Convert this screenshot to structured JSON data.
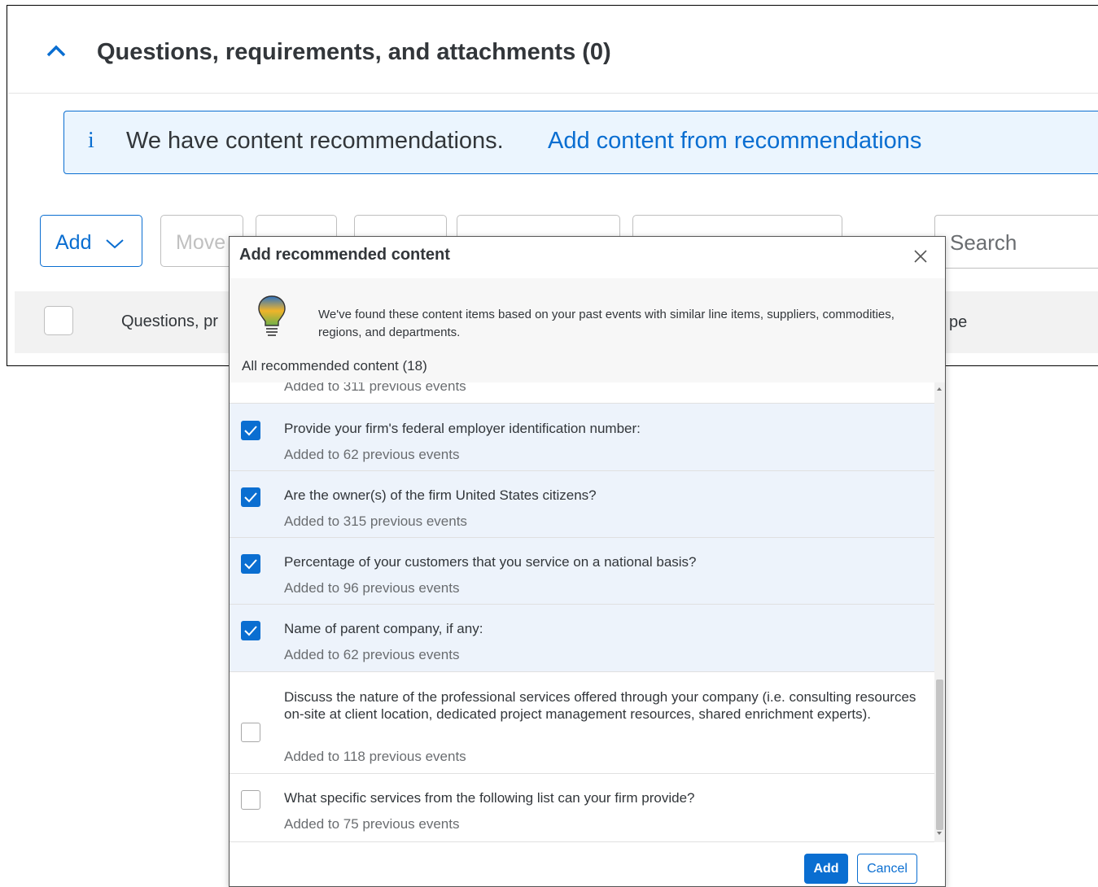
{
  "section": {
    "title": "Questions, requirements, and attachments (0)"
  },
  "info": {
    "text": "We have content recommendations.",
    "link": "Add content from recommendations"
  },
  "toolbar": {
    "add_label": "Add",
    "move_label": "Move",
    "search_placeholder": "Search"
  },
  "table": {
    "col1": "Questions, pr",
    "col2": "pe"
  },
  "dialog": {
    "title": "Add recommended content",
    "banner_text": "We've found these content items based on your past events with similar line items, suppliers, commodities, regions, and departments.",
    "count_label": "All recommended content (18)",
    "items": [
      {
        "title": "",
        "subtitle": "Added to 311 previous events",
        "checked": null
      },
      {
        "title": "Provide your firm's federal employer identification number:",
        "subtitle": "Added to 62 previous events",
        "checked": true
      },
      {
        "title": "Are the owner(s) of the firm United States citizens?",
        "subtitle": "Added to 315 previous events",
        "checked": true
      },
      {
        "title": "Percentage of your customers that you service on a national basis?",
        "subtitle": "Added to 96 previous events",
        "checked": true
      },
      {
        "title": "Name of parent company, if any:",
        "subtitle": "Added to 62 previous events",
        "checked": true
      },
      {
        "title": "Discuss the nature of the professional services offered through your company (i.e. consulting resources on-site at client location, dedicated project management resources, shared enrichment experts).",
        "subtitle": "Added to 118 previous events",
        "checked": false
      },
      {
        "title": "What specific services from the following list can your firm provide?",
        "subtitle": "Added to 75 previous events",
        "checked": false
      }
    ],
    "add_button": "Add",
    "cancel_button": "Cancel"
  },
  "colors": {
    "accent": "#0a6ed1",
    "selected_row": "#edf3fb",
    "info_bg": "#ebf5fe"
  }
}
